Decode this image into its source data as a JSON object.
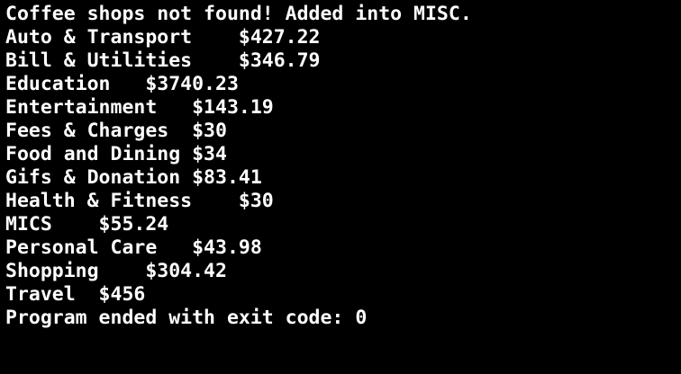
{
  "terminal": {
    "lines": [
      "Coffee shops not found! Added into MISC.",
      "Auto & Transport    $427.22",
      "Bill & Utilities    $346.79",
      "Education   $3740.23",
      "Entertainment   $143.19",
      "Fees & Charges  $30",
      "Food and Dining $34",
      "Gifs & Donation $83.41",
      "Health & Fitness    $30",
      "MICS    $55.24",
      "Personal Care   $43.98",
      "Shopping    $304.42",
      "Travel  $456",
      "Program ended with exit code: 0"
    ],
    "colors": {
      "background": "#000000",
      "text": "#ffffff"
    }
  }
}
